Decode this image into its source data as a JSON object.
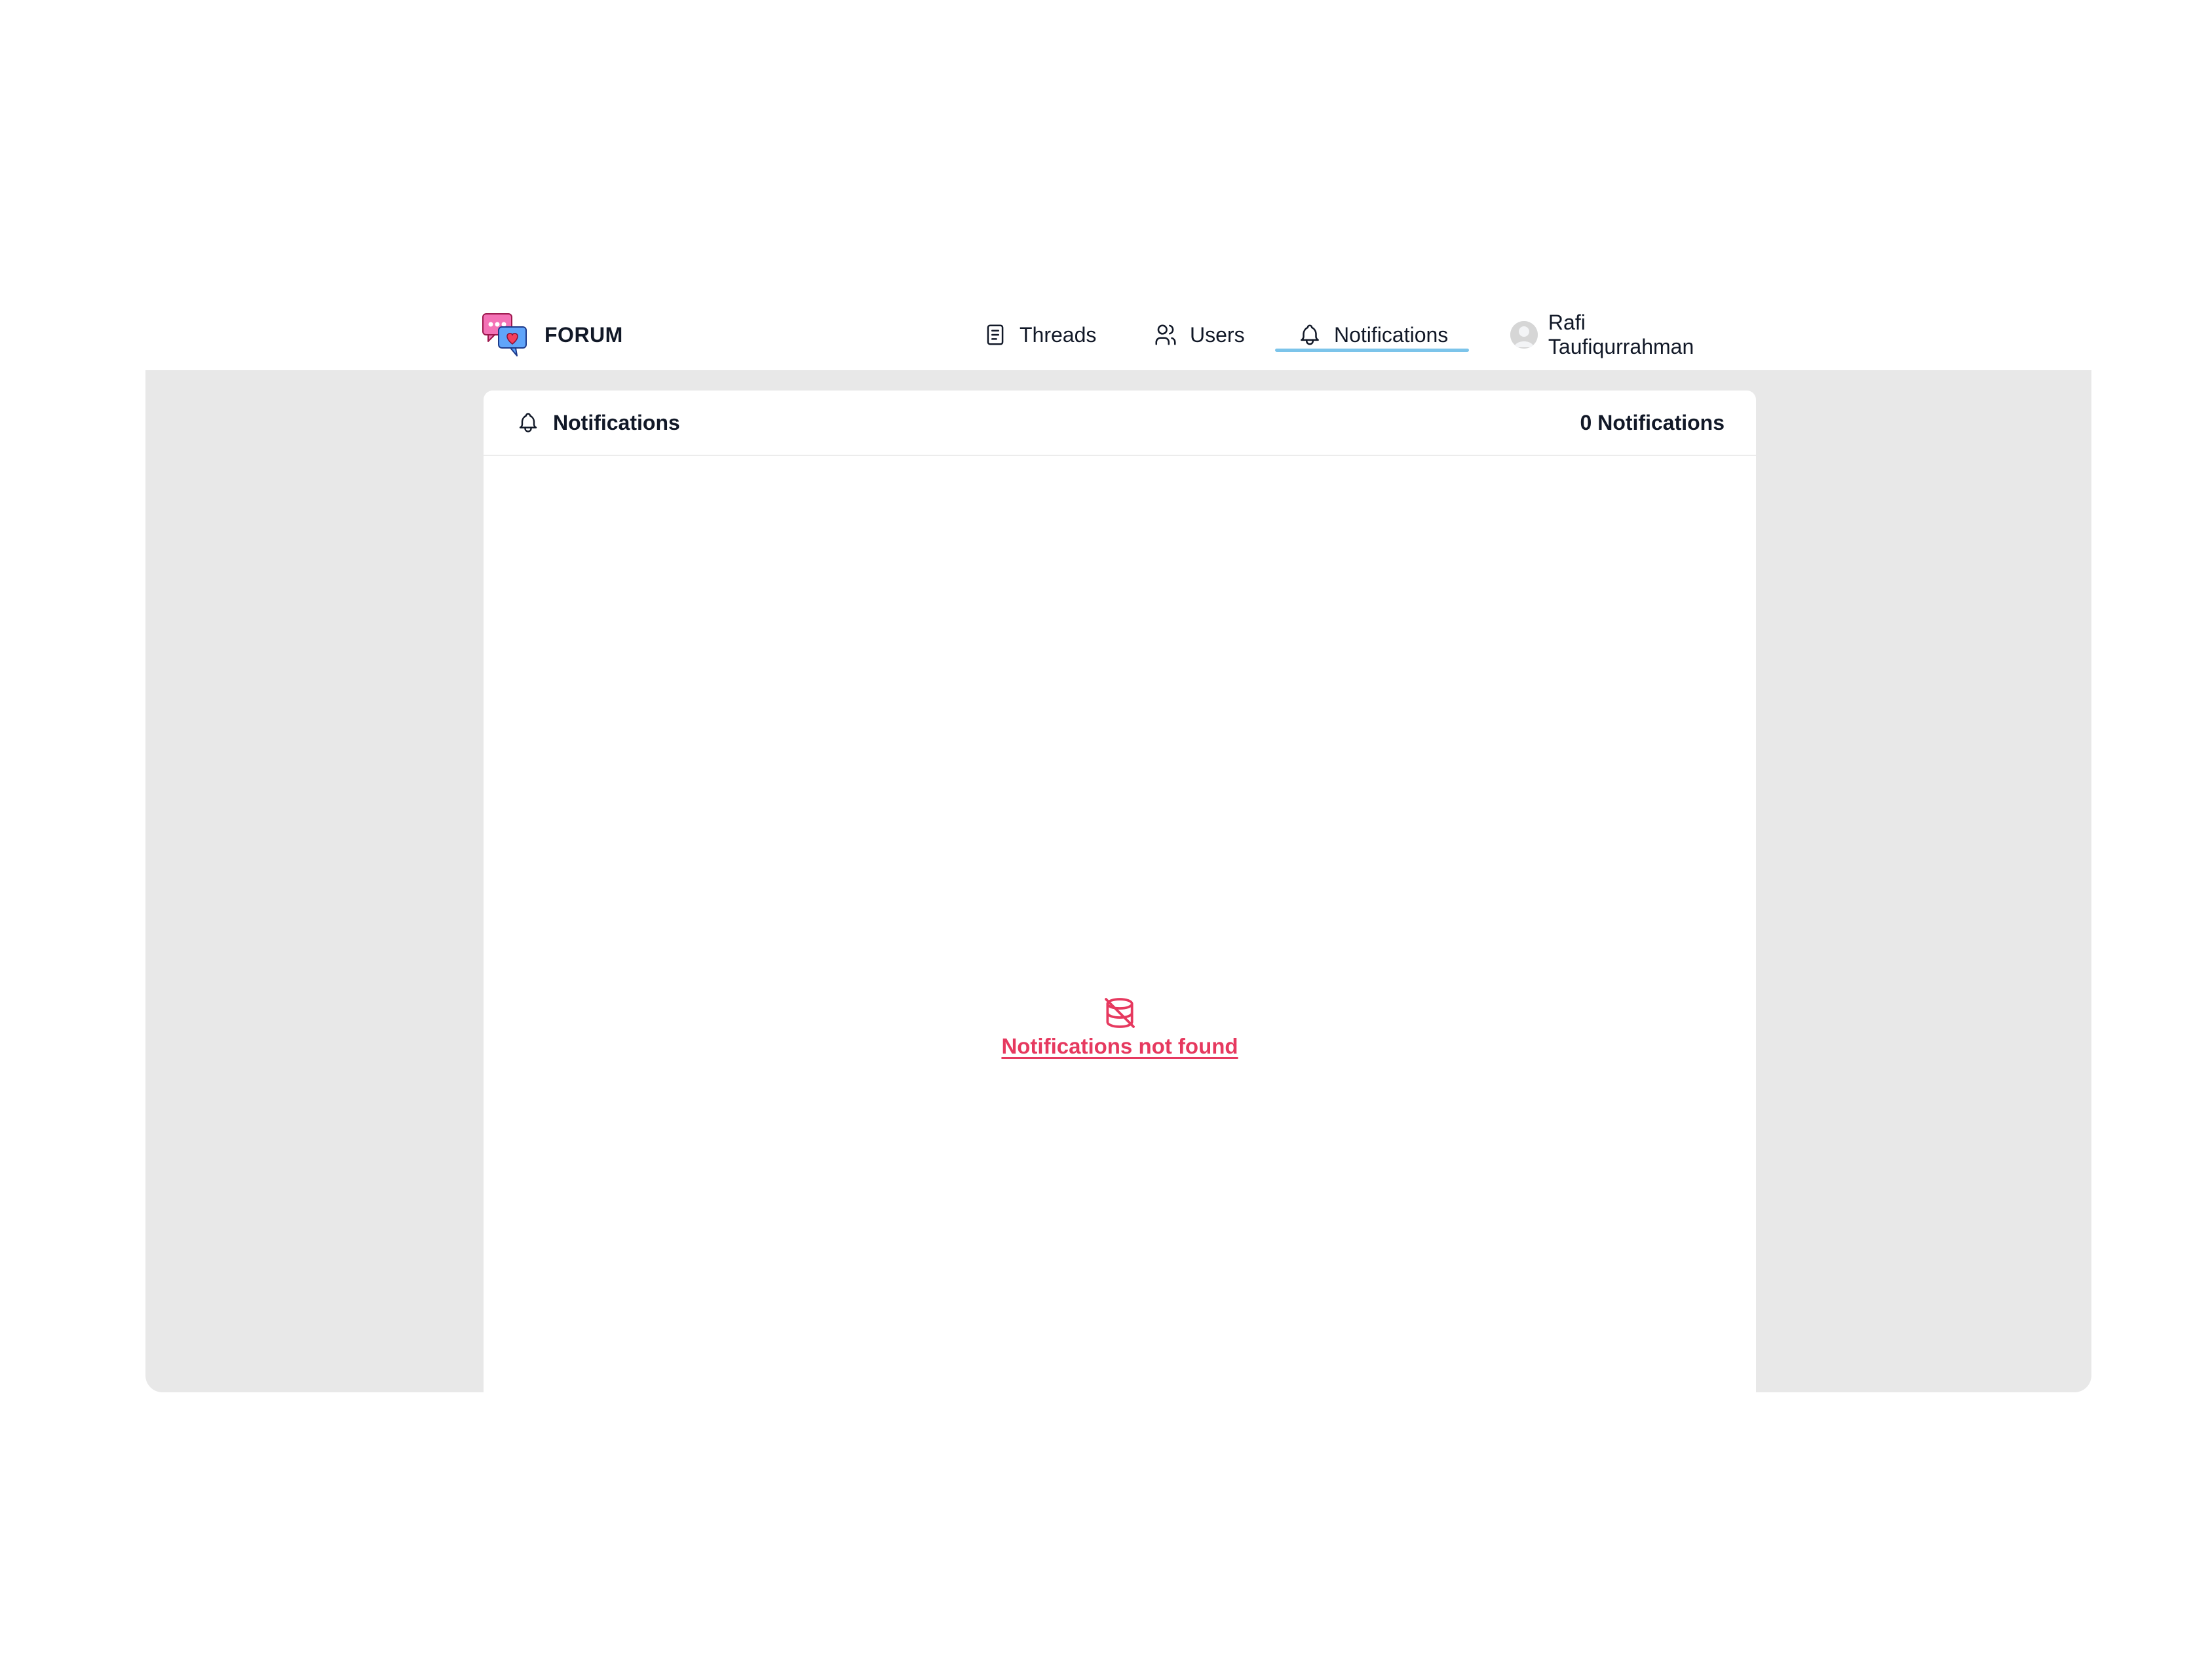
{
  "brand": {
    "name": "FORUM",
    "logo_icon": "chat-bubbles-heart-icon"
  },
  "nav": {
    "items": [
      {
        "label": "Threads",
        "icon": "document-icon"
      },
      {
        "label": "Users",
        "icon": "users-icon"
      },
      {
        "label": "Notifications",
        "icon": "bell-icon",
        "active": true
      }
    ],
    "profile": {
      "name": "Rafi Taufiqurrahman",
      "icon": "avatar"
    }
  },
  "notifications_panel": {
    "title": "Notifications",
    "title_icon": "bell-icon",
    "count_label": "0 Notifications",
    "empty_icon": "database-off-icon",
    "empty_message": "Notifications not found"
  },
  "colors": {
    "accent_underline": "#7cc4ea",
    "empty_text": "#e6395f",
    "background_area": "#e8e8e8"
  }
}
